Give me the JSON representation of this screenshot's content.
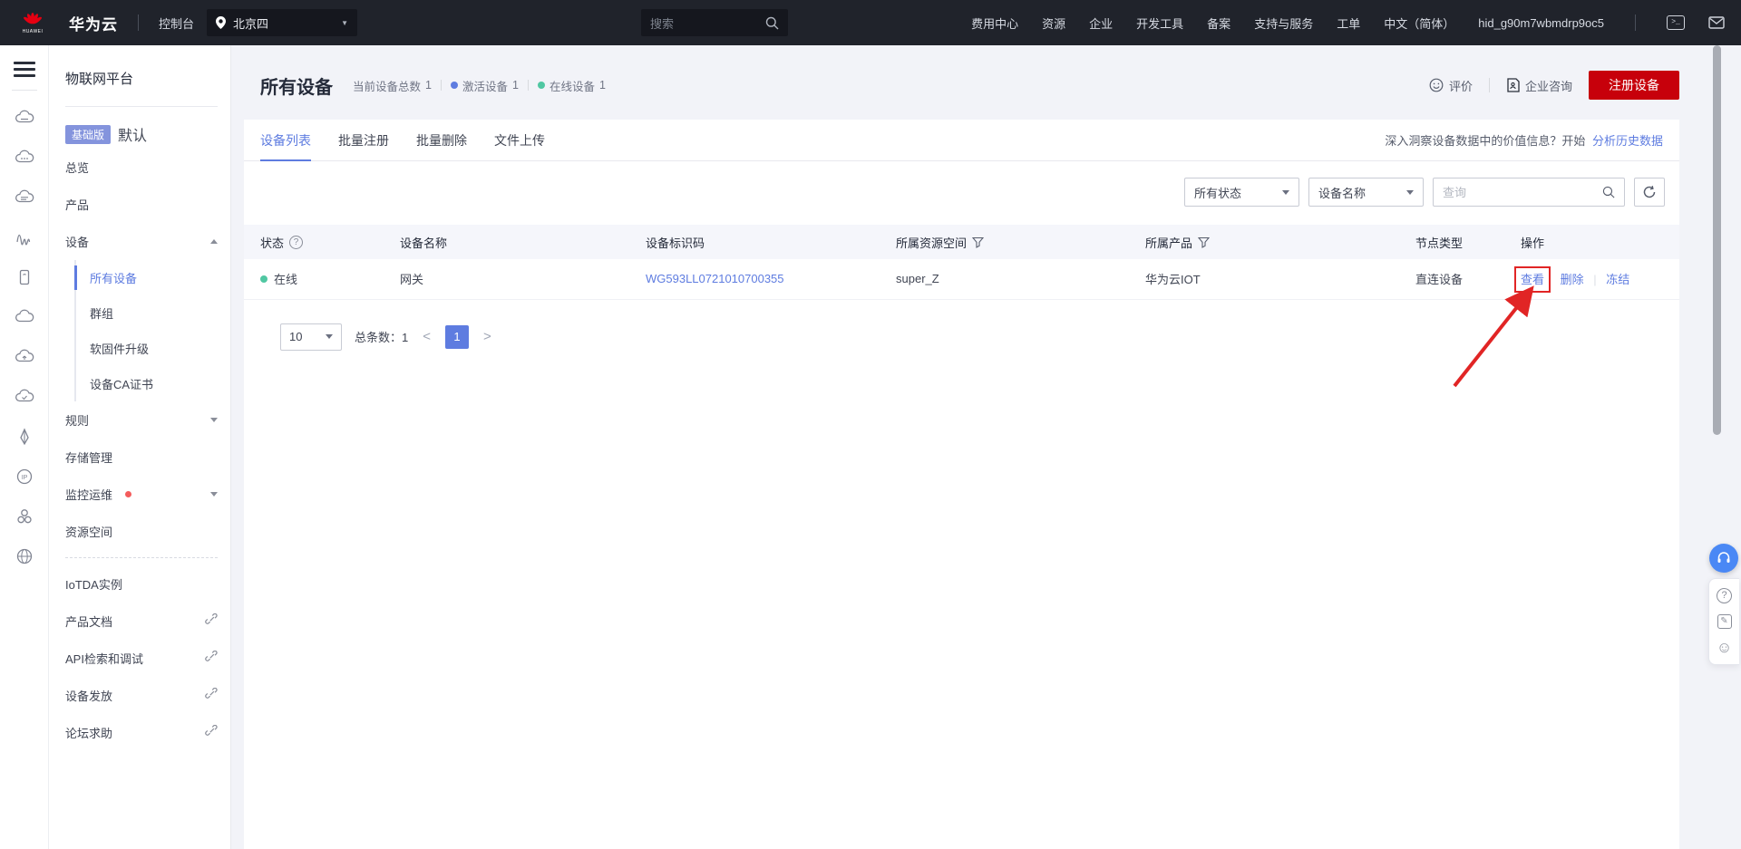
{
  "colors": {
    "accent_blue": "#5e7ce0",
    "huawei_red": "#c7000b",
    "online_green": "#50c7a2",
    "annotation_red": "#e12525",
    "navbar_bg": "#20232b"
  },
  "navbar": {
    "brand": "华为云",
    "brand_mark": "HUAWEI",
    "console_label": "控制台",
    "region": "北京四",
    "search_placeholder": "搜索",
    "menu": [
      "费用中心",
      "资源",
      "企业",
      "开发工具",
      "备案",
      "支持与服务",
      "工单",
      "中文（简体）"
    ],
    "user_id": "hid_g90m7wbmdrp9oc5"
  },
  "sidebar": {
    "title": "物联网平台",
    "edition_badge": "基础版",
    "edition_name": "默认",
    "items": [
      {
        "label": "总览"
      },
      {
        "label": "产品"
      },
      {
        "label": "设备"
      },
      {
        "label": "所有设备"
      },
      {
        "label": "群组"
      },
      {
        "label": "软固件升级"
      },
      {
        "label": "设备CA证书"
      },
      {
        "label": "规则"
      },
      {
        "label": "存储管理"
      },
      {
        "label": "监控运维"
      },
      {
        "label": "资源空间"
      },
      {
        "label": "IoTDA实例"
      },
      {
        "label": "产品文档"
      },
      {
        "label": "API检索和调试"
      },
      {
        "label": "设备发放"
      },
      {
        "label": "论坛求助"
      }
    ]
  },
  "page": {
    "title": "所有设备",
    "stats": [
      {
        "label": "当前设备总数",
        "value": "1"
      },
      {
        "label": "激活设备",
        "value": "1"
      },
      {
        "label": "在线设备",
        "value": "1"
      }
    ],
    "feedback_label": "评价",
    "consult_label": "企业咨询",
    "register_button": "注册设备"
  },
  "tabs": [
    {
      "label": "设备列表"
    },
    {
      "label": "批量注册"
    },
    {
      "label": "批量删除"
    },
    {
      "label": "文件上传"
    }
  ],
  "insight": {
    "text": "深入洞察设备数据中的价值信息？开始",
    "link": "分析历史数据"
  },
  "filters": {
    "status": "所有状态",
    "field": "设备名称",
    "search_placeholder": "查询"
  },
  "table": {
    "columns": [
      {
        "label": "状态"
      },
      {
        "label": "设备名称"
      },
      {
        "label": "设备标识码"
      },
      {
        "label": "所属资源空间"
      },
      {
        "label": "所属产品"
      },
      {
        "label": "节点类型"
      },
      {
        "label": "操作"
      }
    ],
    "rows": [
      {
        "status": "在线",
        "name": "网关",
        "device_id": "WG593LL0721010700355",
        "space": "super_Z",
        "product": "华为云IOT",
        "node_type": "直连设备",
        "action_view": "查看",
        "action_delete": "删除",
        "action_freeze": "冻结"
      }
    ]
  },
  "pagination": {
    "page_size": "10",
    "total_label": "总条数：",
    "total": "1",
    "page": "1"
  }
}
